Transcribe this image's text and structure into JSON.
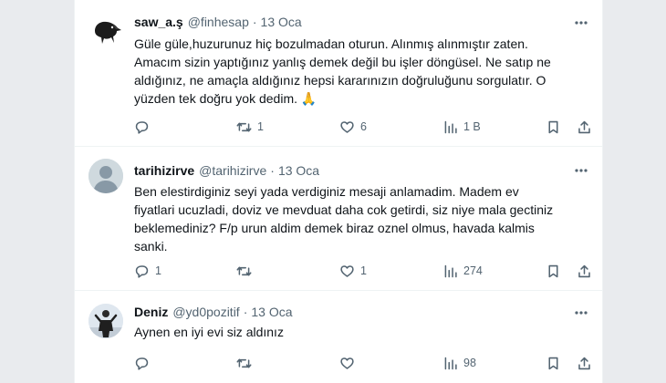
{
  "tweets": [
    {
      "name": "saw_a.ş",
      "handle": "@finhesap",
      "dot": "·",
      "date": "13 Oca",
      "lines": [
        "Güle güle,huzurunuz hiç bozulmadan oturun. Alınmış alınmıştır zaten.",
        "Amacım sizin yaptığınız yanlış demek değil bu işler döngüsel. Ne satıp ne",
        "aldığınız, ne amaçla aldığınız hepsi kararınızın doğruluğunu sorgulatır. O",
        "yüzden tek doğru yok dedim. 🙏"
      ],
      "replies": "",
      "retweets": "1",
      "likes": "6",
      "views": "1 B"
    },
    {
      "name": "tarihizirve",
      "handle": "@tarihizirve",
      "dot": "·",
      "date": "13 Oca",
      "lines": [
        "Ben elestirdiginiz seyi yada verdiginiz mesaji anlamadim. Madem ev",
        "fiyatlari ucuzladi, doviz ve mevduat daha cok getirdi, siz niye mala gectiniz",
        "beklemediniz? F/p urun aldim demek biraz oznel olmus, havada kalmis",
        "sanki."
      ],
      "replies": "1",
      "retweets": "",
      "likes": "1",
      "views": "274"
    },
    {
      "name": "Deniz",
      "handle": "@yd0pozitif",
      "dot": "·",
      "date": "13 Oca",
      "lines": [
        "Aynen en iyi evi siz aldınız"
      ],
      "replies": "",
      "retweets": "",
      "likes": "",
      "views": "98"
    }
  ],
  "icons": {
    "reply": "reply-icon",
    "retweet": "retweet-icon",
    "like": "heart-icon",
    "views": "views-icon",
    "bookmark": "bookmark-icon",
    "share": "share-icon",
    "more": "more-icon"
  },
  "colors": {
    "text": "#0f1419",
    "secondary": "#536471",
    "divider": "#eff3f4",
    "page_background": "#e9ebee"
  }
}
